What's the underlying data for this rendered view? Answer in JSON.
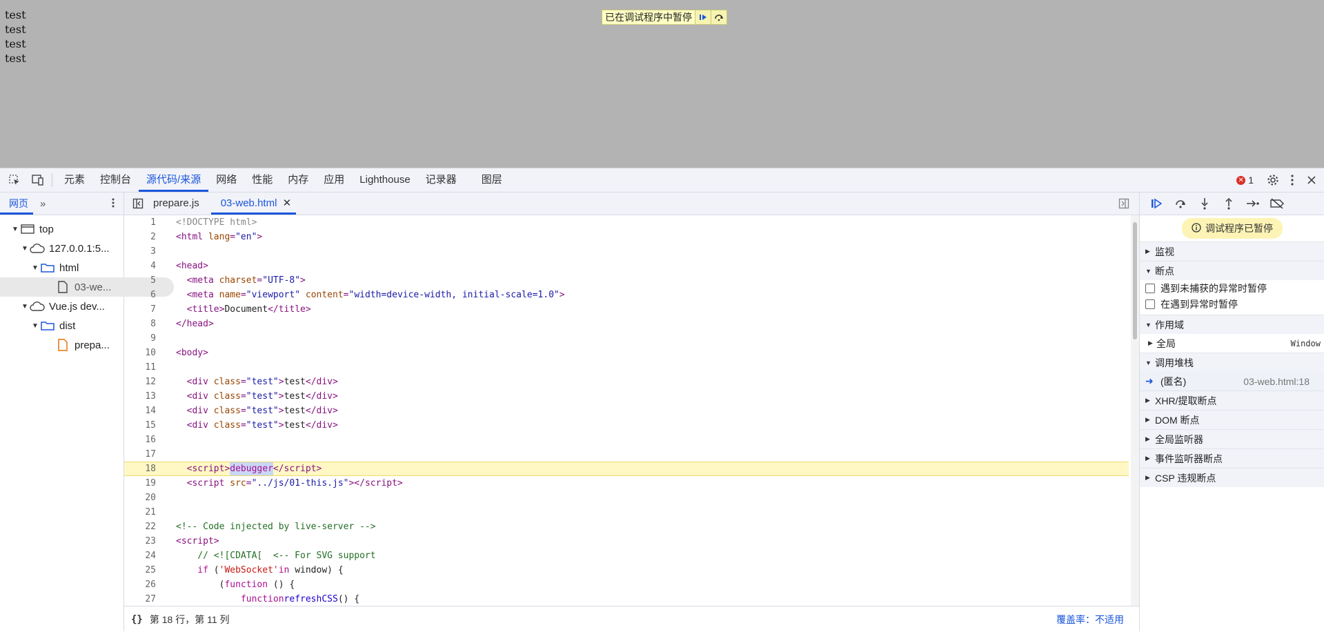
{
  "page": {
    "lines": [
      "test",
      "test",
      "test",
      "test"
    ],
    "paused_banner": "已在调试程序中暂停"
  },
  "devtools": {
    "tabs": [
      "元素",
      "控制台",
      "源代码/来源",
      "网络",
      "性能",
      "内存",
      "应用",
      "Lighthouse",
      "记录器",
      "图层"
    ],
    "active_tab": "源代码/来源",
    "error_count": "1"
  },
  "navigator": {
    "tab": "网页",
    "tree": [
      {
        "label": "top",
        "icon": "frame-icon",
        "depth": 0
      },
      {
        "label": "127.0.0.1:5...",
        "icon": "cloud-icon",
        "depth": 1
      },
      {
        "label": "html",
        "icon": "folder-icon",
        "depth": 2
      },
      {
        "label": "03-we...",
        "icon": "file-icon",
        "depth": 3
      },
      {
        "label": "Vue.js dev...",
        "icon": "cloud-icon",
        "depth": 1
      },
      {
        "label": "dist",
        "icon": "folder-icon",
        "depth": 2
      },
      {
        "label": "prepa...",
        "icon": "js-file-icon",
        "depth": 3
      }
    ]
  },
  "editor": {
    "files": [
      "prepare.js",
      "03-web.html"
    ],
    "active_file": "03-web.html",
    "status_position": "第 18 行，第 11 列",
    "coverage": "覆盖率：不适用"
  },
  "debugger": {
    "paused_pill": "调试程序已暂停",
    "sections": {
      "watch": "监视",
      "breakpoints": "断点",
      "pause_uncaught": "遇到未捕获的异常时暂停",
      "pause_caught": "在遇到异常时暂停",
      "scope": "作用域",
      "scope_global": "全局",
      "scope_global_value": "Window",
      "call_stack": "调用堆栈",
      "frame_name": "(匿名)",
      "frame_location": "03-web.html:18",
      "xhr": "XHR/提取断点",
      "dom": "DOM 断点",
      "global_listeners": "全局监听器",
      "event_listeners": "事件监听器断点",
      "csp": "CSP 违规断点"
    }
  },
  "colors": {
    "accent": "#1a56db",
    "paused_line": "#fff8c4",
    "page_overlay": "#b3b3b3"
  }
}
